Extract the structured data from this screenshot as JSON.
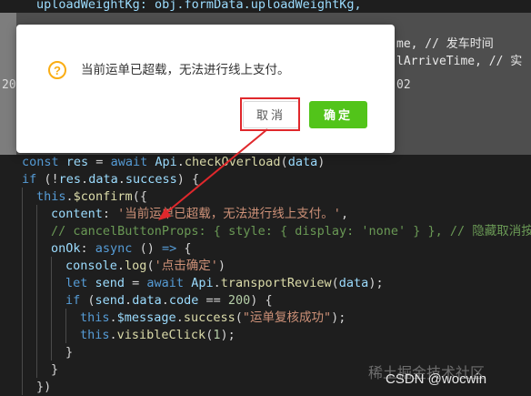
{
  "code_top": "uploadWeightKg: obj.formData.uploadWeightKg,",
  "behind_right_1": "me, // 发车时间",
  "behind_right_2": "lArriveTime, // 实",
  "behind_left_num": "20",
  "behind_right_num": "02",
  "dialog": {
    "icon": "warning-icon",
    "icon_glyph": "?",
    "message": "当前运单已超载，无法进行线上支付。",
    "cancel_label": "取消",
    "ok_label": "确定"
  },
  "colors": {
    "ok_button": "#52c41a",
    "warning_icon": "#faad14",
    "annotation": "#e0282c",
    "editor_bg": "#1e1e1e"
  },
  "code": {
    "l1": [
      "const ",
      "res",
      " = ",
      "await ",
      "Api",
      ".",
      "checkOverload",
      "(",
      "data",
      ")"
    ],
    "l2": [
      "if ",
      "(!",
      "res",
      ".",
      "data",
      ".",
      "success",
      ") {"
    ],
    "l3": [
      "this",
      ".",
      "$confirm",
      "({"
    ],
    "l4": [
      "content",
      ": ",
      "'当前运单已超载，无法进行线上支付。'",
      ","
    ],
    "l5": "// cancelButtonProps: { style: { display: 'none' } }, // 隐藏取消按钮",
    "l6": [
      "onOk",
      ": ",
      "async ",
      "() ",
      "=> ",
      "{"
    ],
    "l7": [
      "console",
      ".",
      "log",
      "(",
      "'点击确定'",
      ")"
    ],
    "l8": [
      "let ",
      "send",
      " = ",
      "await ",
      "Api",
      ".",
      "transportReview",
      "(",
      "data",
      ");"
    ],
    "l9": [
      "if ",
      "(",
      "send",
      ".",
      "data",
      ".",
      "code",
      " == ",
      "200",
      ") {"
    ],
    "l10": [
      "this",
      ".",
      "$message",
      ".",
      "success",
      "(",
      "\"运单复核成功\"",
      ");"
    ],
    "l11": [
      "this",
      ".",
      "visibleClick",
      "(",
      "1",
      ");"
    ],
    "l12": "}",
    "l13": "}",
    "l14": "})"
  },
  "watermark": "稀土掘金技术社区",
  "csdn": "CSDN @wocwin"
}
